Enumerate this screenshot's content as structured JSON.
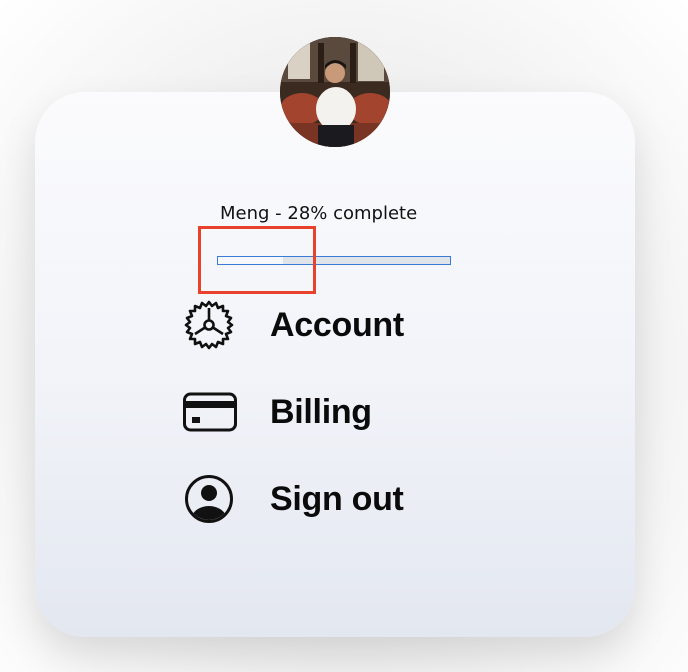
{
  "user": {
    "name": "Meng",
    "progress_text": "Meng - 28% complete",
    "progress_fraction": 0.28
  },
  "menu": {
    "items": [
      {
        "label": "Account",
        "icon": "gear-icon"
      },
      {
        "label": "Billing",
        "icon": "credit-card-icon"
      },
      {
        "label": "Sign out",
        "icon": "user-circle-icon"
      }
    ]
  },
  "colors": {
    "accent": "#3a7bd5",
    "highlight": "#e8412c",
    "text": "#0b0b0b"
  }
}
